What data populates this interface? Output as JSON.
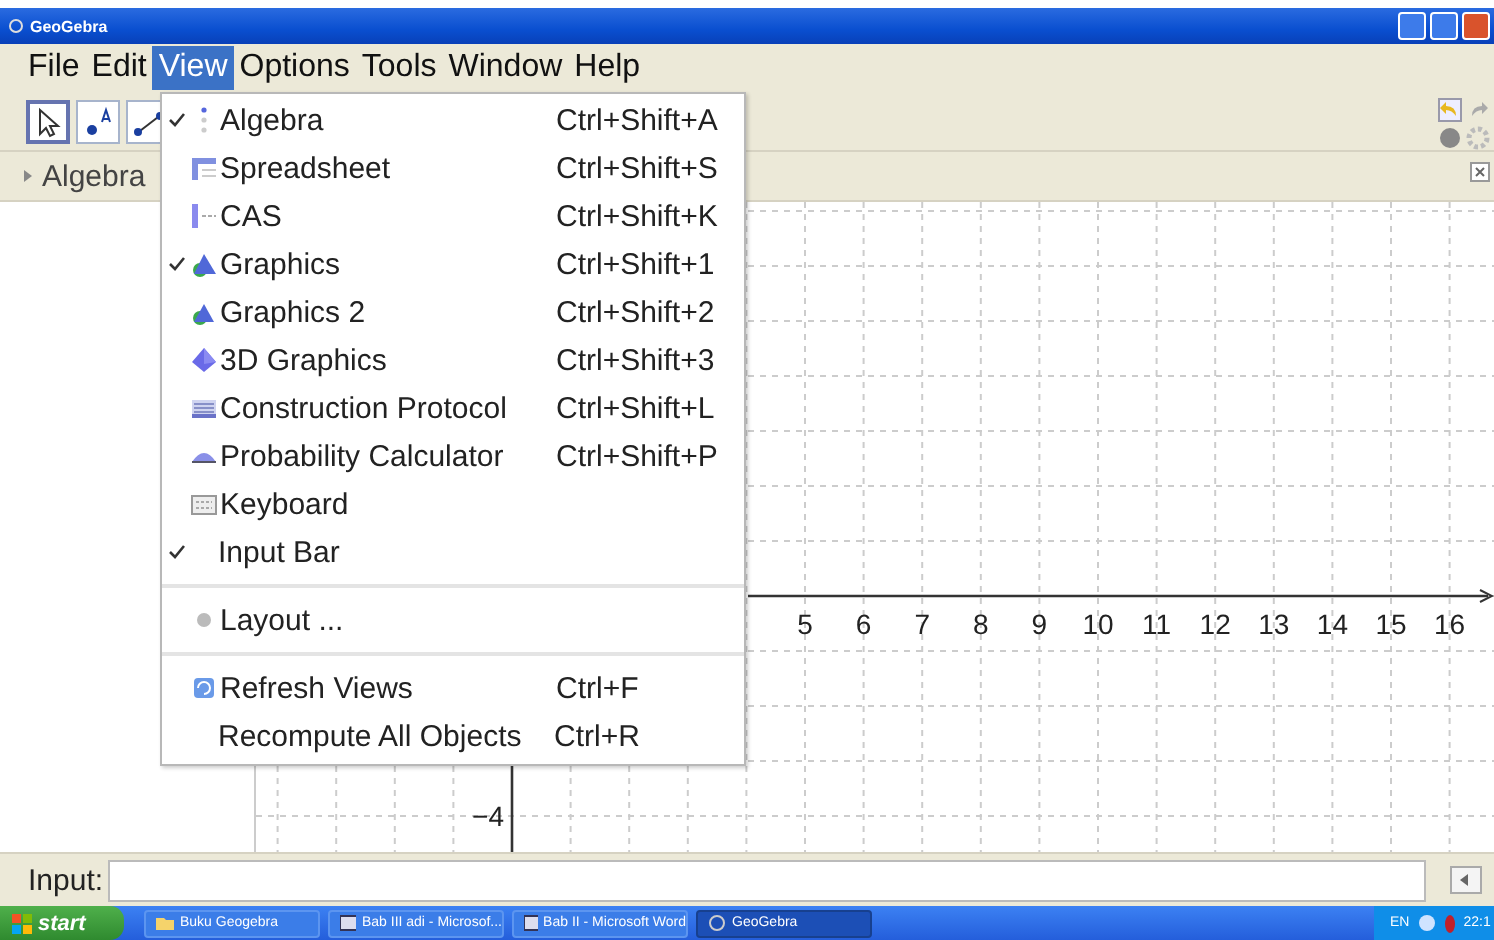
{
  "window": {
    "title": "GeoGebra"
  },
  "menu_bar": [
    {
      "label": "File",
      "selected": false
    },
    {
      "label": "Edit",
      "selected": false
    },
    {
      "label": "View",
      "selected": true
    },
    {
      "label": "Options",
      "selected": false
    },
    {
      "label": "Tools",
      "selected": false
    },
    {
      "label": "Window",
      "selected": false
    },
    {
      "label": "Help",
      "selected": false
    }
  ],
  "toolbar": {
    "tools": [
      {
        "kind": "move",
        "selected": true
      },
      {
        "kind": "point",
        "selected": false
      },
      {
        "kind": "line",
        "selected": false
      }
    ]
  },
  "algebra_view": {
    "title": "Algebra"
  },
  "graphics_view": {
    "x_axis_labels": [
      "5",
      "6",
      "7",
      "8",
      "9",
      "10",
      "11",
      "12",
      "13",
      "14",
      "15",
      "16"
    ],
    "y_axis_labels": [
      "−4"
    ]
  },
  "view_menu": [
    {
      "kind": "item",
      "label": "Algebra",
      "shortcut": "Ctrl+Shift+A",
      "checked": true
    },
    {
      "kind": "item",
      "label": "Spreadsheet",
      "shortcut": "Ctrl+Shift+S",
      "checked": false
    },
    {
      "kind": "item",
      "label": "CAS",
      "shortcut": "Ctrl+Shift+K",
      "checked": false
    },
    {
      "kind": "item",
      "label": "Graphics",
      "shortcut": "Ctrl+Shift+1",
      "checked": true
    },
    {
      "kind": "item",
      "label": "Graphics 2",
      "shortcut": "Ctrl+Shift+2",
      "checked": false
    },
    {
      "kind": "item",
      "label": "3D Graphics",
      "shortcut": "Ctrl+Shift+3",
      "checked": false
    },
    {
      "kind": "item",
      "label": "Construction Protocol",
      "shortcut": "Ctrl+Shift+L",
      "checked": false
    },
    {
      "kind": "item",
      "label": "Probability Calculator",
      "shortcut": "Ctrl+Shift+P",
      "checked": false
    },
    {
      "kind": "item",
      "label": "Keyboard",
      "checked": false
    },
    {
      "kind": "item",
      "label": "Input Bar",
      "checked": true
    },
    {
      "kind": "separator"
    },
    {
      "kind": "item",
      "label": "Layout ...",
      "checked": false
    },
    {
      "kind": "separator"
    },
    {
      "kind": "item",
      "label": "Refresh Views",
      "shortcut": "Ctrl+F",
      "checked": false
    },
    {
      "kind": "item",
      "label": "Recompute All Objects",
      "shortcut": "Ctrl+R",
      "checked": false
    }
  ],
  "input_bar": {
    "label": "Input:"
  },
  "taskbar": {
    "start": "start",
    "tasks": [
      {
        "label": "Buku Geogebra",
        "selected": false
      },
      {
        "label": "Bab III adi - Microsof...",
        "selected": false
      },
      {
        "label": "Bab II - Microsoft Word",
        "selected": false
      },
      {
        "label": "GeoGebra",
        "selected": true
      }
    ],
    "language": "EN",
    "clock": "22:1"
  }
}
